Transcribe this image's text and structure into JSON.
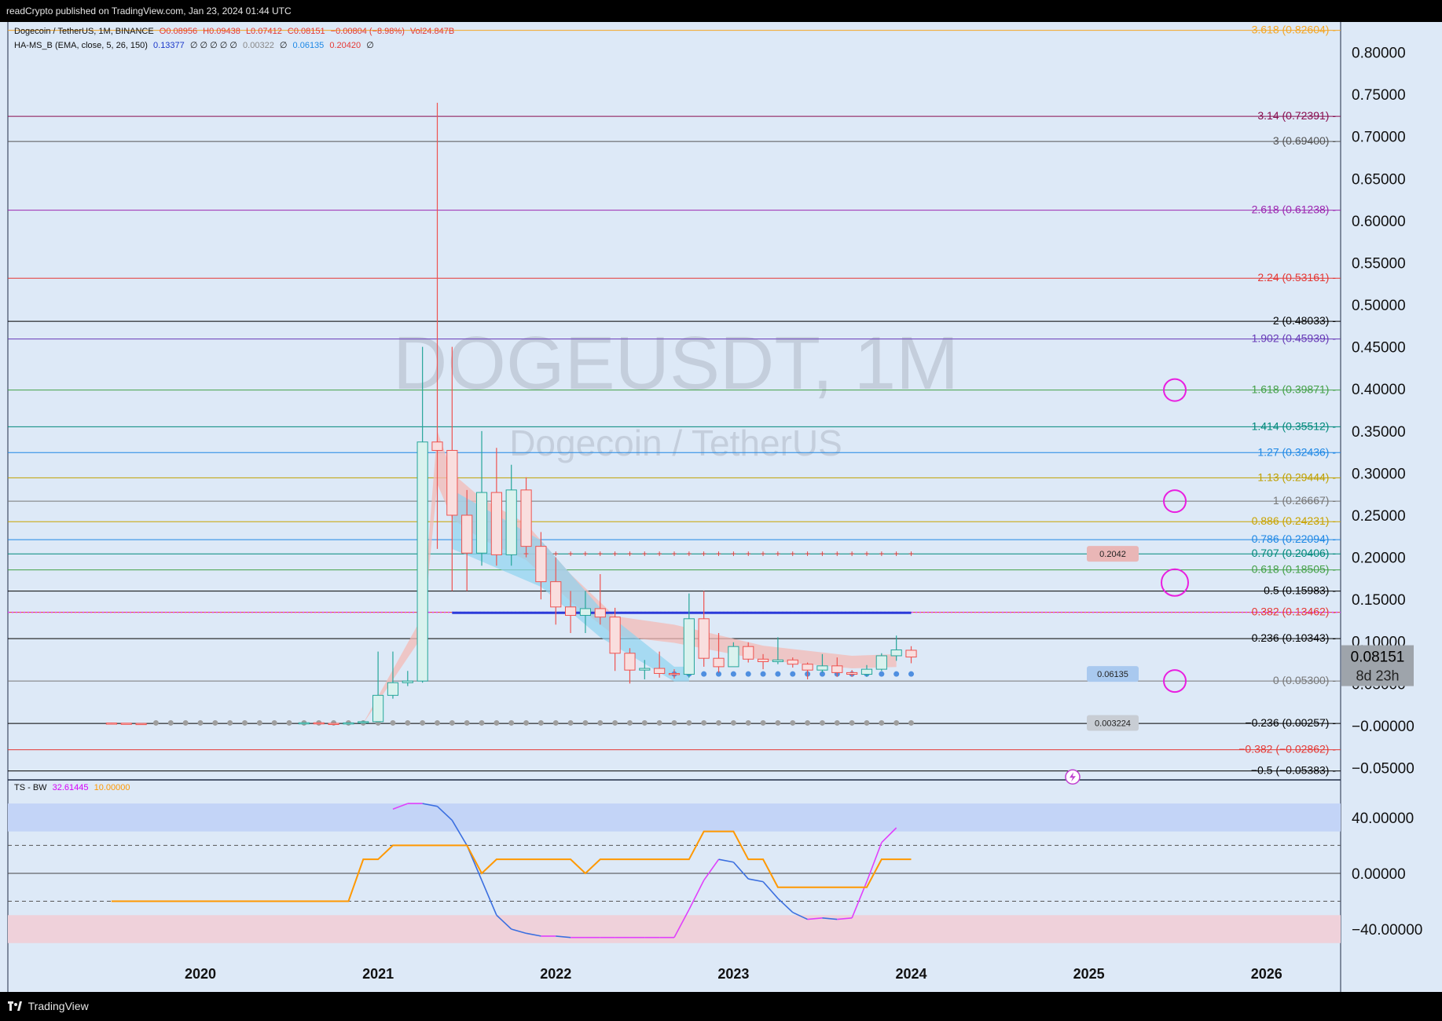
{
  "header": {
    "publisher": "readCrypto published on TradingView.com, Jan 23, 2024 01:44 UTC"
  },
  "footer": {
    "brand": "TradingView"
  },
  "colors": {
    "bg": "#dde9f7",
    "up": "#26a69a",
    "down": "#ef5350",
    "osc_blue": "#3b6fe0",
    "osc_magenta": "#e040fb",
    "signal": "#ff9800"
  },
  "legend_main": {
    "symbol": "Dogecoin / TetherUS, 1M, BINANCE",
    "o": "O0.08956",
    "h": "H0.09438",
    "l": "L0.07412",
    "c": "C0.08151",
    "chg": "−0.00804 (−8.98%)",
    "vol": "Vol24.847B"
  },
  "legend_ind": {
    "name": "HA-MS_B (EMA, close, 5, 26, 150)",
    "v1": "0.13377",
    "v2": "∅ ∅ ∅ ∅ ∅",
    "v3": "0.00322",
    "v4": "∅",
    "v5": "0.06135",
    "v6": "0.20420",
    "v7": "∅"
  },
  "legend_osc": {
    "name": "TS - BW",
    "v1": "32.61445",
    "v2": "10.00000"
  },
  "watermark": {
    "title": "DOGEUSDT, 1M",
    "subtitle": "Dogecoin / TetherUS"
  },
  "chart_data": [
    {
      "type": "candlestick",
      "title": "DOGEUSDT, 1M",
      "x_ticks": [
        "2020",
        "2021",
        "2022",
        "2023",
        "2024",
        "2025",
        "2026"
      ],
      "y_ticks": [
        "0.80000",
        "0.75000",
        "0.70000",
        "0.65000",
        "0.60000",
        "0.55000",
        "0.50000",
        "0.45000",
        "0.40000",
        "0.35000",
        "0.30000",
        "0.25000",
        "0.20000",
        "0.15000",
        "0.10000",
        "0.05000",
        "−0.00000",
        "−0.05000"
      ],
      "ylim": [
        -0.057,
        0.836
      ],
      "xlim": [
        "2018-12",
        "2026-06"
      ],
      "fib_levels": [
        {
          "label": "3.618 (0.82604)",
          "value": 0.82604,
          "color": "#f5a623"
        },
        {
          "label": "3.14 (0.72391)",
          "value": 0.72391,
          "color": "#880e4f"
        },
        {
          "label": "3 (0.69400)",
          "value": 0.694,
          "color": "#555555"
        },
        {
          "label": "2.618 (0.61238)",
          "value": 0.61238,
          "color": "#9c27b0"
        },
        {
          "label": "2.24 (0.53161)",
          "value": 0.53161,
          "color": "#e53935"
        },
        {
          "label": "2 (0.48033)",
          "value": 0.48033,
          "color": "#000000"
        },
        {
          "label": "1.902 (0.45939)",
          "value": 0.45939,
          "color": "#673ab7"
        },
        {
          "label": "1.618 (0.39871)",
          "value": 0.39871,
          "color": "#43a047"
        },
        {
          "label": "1.414 (0.35512)",
          "value": 0.35512,
          "color": "#00897b"
        },
        {
          "label": "1.27 (0.32436)",
          "value": 0.32436,
          "color": "#1e88e5"
        },
        {
          "label": "1.13 (0.29444)",
          "value": 0.29444,
          "color": "#c0a000"
        },
        {
          "label": "1 (0.26667)",
          "value": 0.26667,
          "color": "#777777"
        },
        {
          "label": "0.886 (0.24231)",
          "value": 0.24231,
          "color": "#c9a300"
        },
        {
          "label": "0.786 (0.22094)",
          "value": 0.22094,
          "color": "#1e88e5"
        },
        {
          "label": "0.707 (0.20406)",
          "value": 0.20406,
          "color": "#00897b"
        },
        {
          "label": "0.618 (0.18505)",
          "value": 0.18505,
          "color": "#43a047"
        },
        {
          "label": "0.5 (0.15983)",
          "value": 0.15983,
          "color": "#000000"
        },
        {
          "label": "0.382 (0.13462)",
          "value": 0.13462,
          "color": "#e53935"
        },
        {
          "label": "0.236 (0.10343)",
          "value": 0.10343,
          "color": "#000000"
        },
        {
          "label": "0 (0.05300)",
          "value": 0.053,
          "color": "#777777"
        },
        {
          "label": "−0.236 (0.00257)",
          "value": 0.00257,
          "color": "#000000"
        },
        {
          "label": "−0.382 (−0.02862)",
          "value": -0.02862,
          "color": "#e53935"
        },
        {
          "label": "−0.5 (−0.05383)",
          "value": -0.05383,
          "color": "#000000"
        }
      ],
      "candles": [
        {
          "t": "2019-07",
          "o": 0.0031,
          "h": 0.0035,
          "l": 0.0028,
          "c": 0.0029
        },
        {
          "t": "2019-08",
          "o": 0.0029,
          "h": 0.0031,
          "l": 0.0025,
          "c": 0.0026
        },
        {
          "t": "2019-09",
          "o": 0.0026,
          "h": 0.0028,
          "l": 0.0024,
          "c": 0.0025
        },
        {
          "t": "2020-08",
          "o": 0.0028,
          "h": 0.0035,
          "l": 0.0027,
          "c": 0.0034
        },
        {
          "t": "2020-09",
          "o": 0.0034,
          "h": 0.0035,
          "l": 0.0026,
          "c": 0.0027
        },
        {
          "t": "2020-10",
          "o": 0.0027,
          "h": 0.0028,
          "l": 0.0025,
          "c": 0.0026
        },
        {
          "t": "2020-11",
          "o": 0.0026,
          "h": 0.0035,
          "l": 0.0025,
          "c": 0.0033
        },
        {
          "t": "2020-12",
          "o": 0.0033,
          "h": 0.0056,
          "l": 0.003,
          "c": 0.0047
        },
        {
          "t": "2021-01",
          "o": 0.0047,
          "h": 0.088,
          "l": 0.0045,
          "c": 0.036
        },
        {
          "t": "2021-02",
          "o": 0.036,
          "h": 0.088,
          "l": 0.032,
          "c": 0.051
        },
        {
          "t": "2021-03",
          "o": 0.051,
          "h": 0.065,
          "l": 0.047,
          "c": 0.053
        },
        {
          "t": "2021-04",
          "o": 0.053,
          "h": 0.45,
          "l": 0.051,
          "c": 0.337
        },
        {
          "t": "2021-05",
          "o": 0.337,
          "h": 0.74,
          "l": 0.21,
          "c": 0.327
        },
        {
          "t": "2021-06",
          "o": 0.327,
          "h": 0.45,
          "l": 0.16,
          "c": 0.25
        },
        {
          "t": "2021-07",
          "o": 0.25,
          "h": 0.28,
          "l": 0.16,
          "c": 0.205
        },
        {
          "t": "2021-08",
          "o": 0.205,
          "h": 0.35,
          "l": 0.19,
          "c": 0.277
        },
        {
          "t": "2021-09",
          "o": 0.277,
          "h": 0.33,
          "l": 0.19,
          "c": 0.203
        },
        {
          "t": "2021-10",
          "o": 0.203,
          "h": 0.31,
          "l": 0.19,
          "c": 0.28
        },
        {
          "t": "2021-11",
          "o": 0.28,
          "h": 0.295,
          "l": 0.2,
          "c": 0.213
        },
        {
          "t": "2021-12",
          "o": 0.213,
          "h": 0.23,
          "l": 0.15,
          "c": 0.171
        },
        {
          "t": "2022-01",
          "o": 0.171,
          "h": 0.2,
          "l": 0.12,
          "c": 0.141
        },
        {
          "t": "2022-02",
          "o": 0.141,
          "h": 0.16,
          "l": 0.11,
          "c": 0.131
        },
        {
          "t": "2022-03",
          "o": 0.131,
          "h": 0.16,
          "l": 0.11,
          "c": 0.139
        },
        {
          "t": "2022-04",
          "o": 0.139,
          "h": 0.18,
          "l": 0.12,
          "c": 0.129
        },
        {
          "t": "2022-05",
          "o": 0.129,
          "h": 0.14,
          "l": 0.065,
          "c": 0.086
        },
        {
          "t": "2022-06",
          "o": 0.086,
          "h": 0.092,
          "l": 0.05,
          "c": 0.066
        },
        {
          "t": "2022-07",
          "o": 0.066,
          "h": 0.078,
          "l": 0.055,
          "c": 0.068
        },
        {
          "t": "2022-08",
          "o": 0.068,
          "h": 0.088,
          "l": 0.057,
          "c": 0.062
        },
        {
          "t": "2022-09",
          "o": 0.062,
          "h": 0.067,
          "l": 0.056,
          "c": 0.061
        },
        {
          "t": "2022-10",
          "o": 0.061,
          "h": 0.157,
          "l": 0.057,
          "c": 0.127
        },
        {
          "t": "2022-11",
          "o": 0.127,
          "h": 0.16,
          "l": 0.07,
          "c": 0.08
        },
        {
          "t": "2022-12",
          "o": 0.08,
          "h": 0.11,
          "l": 0.063,
          "c": 0.07
        },
        {
          "t": "2023-01",
          "o": 0.07,
          "h": 0.099,
          "l": 0.07,
          "c": 0.094
        },
        {
          "t": "2023-02",
          "o": 0.094,
          "h": 0.099,
          "l": 0.075,
          "c": 0.079
        },
        {
          "t": "2023-03",
          "o": 0.079,
          "h": 0.085,
          "l": 0.067,
          "c": 0.076
        },
        {
          "t": "2023-04",
          "o": 0.076,
          "h": 0.105,
          "l": 0.073,
          "c": 0.078
        },
        {
          "t": "2023-05",
          "o": 0.078,
          "h": 0.081,
          "l": 0.069,
          "c": 0.073
        },
        {
          "t": "2023-06",
          "o": 0.073,
          "h": 0.075,
          "l": 0.055,
          "c": 0.066
        },
        {
          "t": "2023-07",
          "o": 0.066,
          "h": 0.085,
          "l": 0.063,
          "c": 0.071
        },
        {
          "t": "2023-08",
          "o": 0.071,
          "h": 0.081,
          "l": 0.058,
          "c": 0.063
        },
        {
          "t": "2023-09",
          "o": 0.063,
          "h": 0.066,
          "l": 0.058,
          "c": 0.061
        },
        {
          "t": "2023-10",
          "o": 0.061,
          "h": 0.072,
          "l": 0.058,
          "c": 0.067
        },
        {
          "t": "2023-11",
          "o": 0.067,
          "h": 0.086,
          "l": 0.065,
          "c": 0.083
        },
        {
          "t": "2023-12",
          "o": 0.083,
          "h": 0.107,
          "l": 0.077,
          "c": 0.09
        },
        {
          "t": "2024-01",
          "o": 0.08956,
          "h": 0.09438,
          "l": 0.07412,
          "c": 0.08151
        }
      ],
      "dotted_levels": [
        {
          "label": "0.2042",
          "value": 0.2042,
          "from": "2021-10",
          "to": "2024-01",
          "color": "#e53935"
        },
        {
          "label": "0.06135",
          "value": 0.06135,
          "from": "2022-09",
          "to": "2024-01",
          "color": "#4f8fe0"
        },
        {
          "label": "0.003224",
          "value": 0.003224,
          "from": "2019-10",
          "to": "2024-01",
          "color": "#9e9e9e"
        }
      ],
      "blue_line": {
        "value": 0.134,
        "from": "2021-06",
        "to": "2024-01"
      },
      "circles": [
        0.39871,
        0.26667,
        0.17,
        0.053
      ],
      "price_tag": {
        "price": "0.08151",
        "countdown": "8d 23h"
      },
      "flash_icon": "lightning-icon"
    },
    {
      "type": "line",
      "title": "TS - BW",
      "y_ticks": [
        "40.00000",
        "0.00000",
        "−40.00000"
      ],
      "ylim": [
        -58,
        63
      ],
      "bands": {
        "upper": [
          30,
          50
        ],
        "lower": [
          -50,
          -30
        ],
        "dashed": [
          20,
          -20
        ]
      },
      "series": [
        {
          "values": [
            [
              "2021-02",
              46
            ],
            [
              "2021-03",
              50
            ],
            [
              "2021-04",
              50
            ],
            [
              "2021-05",
              48
            ],
            [
              "2021-06",
              38
            ],
            [
              "2021-07",
              20
            ],
            [
              "2021-08",
              -5
            ],
            [
              "2021-09",
              -30
            ],
            [
              "2021-10",
              -40
            ],
            [
              "2021-11",
              -43
            ],
            [
              "2021-12",
              -45
            ],
            [
              "2022-01",
              -45
            ],
            [
              "2022-02",
              -46
            ],
            [
              "2022-03",
              -46
            ],
            [
              "2022-04",
              -46
            ],
            [
              "2022-05",
              -46
            ],
            [
              "2022-06",
              -46
            ],
            [
              "2022-07",
              -46
            ],
            [
              "2022-08",
              -46
            ],
            [
              "2022-09",
              -46
            ],
            [
              "2022-10",
              -26
            ],
            [
              "2022-11",
              -5
            ],
            [
              "2022-12",
              10
            ],
            [
              "2023-01",
              8
            ],
            [
              "2023-02",
              -4
            ],
            [
              "2023-03",
              -6
            ],
            [
              "2023-04",
              -18
            ],
            [
              "2023-05",
              -28
            ],
            [
              "2023-06",
              -33
            ],
            [
              "2023-07",
              -32
            ],
            [
              "2023-08",
              -33
            ],
            [
              "2023-09",
              -32
            ],
            [
              "2023-10",
              -6
            ],
            [
              "2023-11",
              22
            ],
            [
              "2023-12",
              32.61
            ]
          ]
        },
        {
          "values": [
            [
              "2019-07",
              -20
            ],
            [
              "2019-08",
              -20
            ],
            [
              "2019-09",
              -20
            ],
            [
              "2019-10",
              -20
            ],
            [
              "2019-11",
              -20
            ],
            [
              "2019-12",
              -20
            ],
            [
              "2020-01",
              -20
            ],
            [
              "2020-02",
              -20
            ],
            [
              "2020-03",
              -20
            ],
            [
              "2020-04",
              -20
            ],
            [
              "2020-05",
              -20
            ],
            [
              "2020-06",
              -20
            ],
            [
              "2020-07",
              -20
            ],
            [
              "2020-08",
              -20
            ],
            [
              "2020-09",
              -20
            ],
            [
              "2020-10",
              -20
            ],
            [
              "2020-11",
              -20
            ],
            [
              "2020-12",
              10
            ],
            [
              "2021-01",
              10
            ],
            [
              "2021-02",
              20
            ],
            [
              "2021-03",
              20
            ],
            [
              "2021-04",
              20
            ],
            [
              "2021-05",
              20
            ],
            [
              "2021-06",
              20
            ],
            [
              "2021-07",
              20
            ],
            [
              "2021-08",
              0
            ],
            [
              "2021-09",
              10
            ],
            [
              "2021-10",
              10
            ],
            [
              "2021-11",
              10
            ],
            [
              "2021-12",
              10
            ],
            [
              "2022-01",
              10
            ],
            [
              "2022-02",
              10
            ],
            [
              "2022-03",
              0
            ],
            [
              "2022-04",
              10
            ],
            [
              "2022-05",
              10
            ],
            [
              "2022-06",
              10
            ],
            [
              "2022-07",
              10
            ],
            [
              "2022-08",
              10
            ],
            [
              "2022-09",
              10
            ],
            [
              "2022-10",
              10
            ],
            [
              "2022-11",
              30
            ],
            [
              "2022-12",
              30
            ],
            [
              "2023-01",
              30
            ],
            [
              "2023-02",
              10
            ],
            [
              "2023-03",
              10
            ],
            [
              "2023-04",
              -10
            ],
            [
              "2023-05",
              -10
            ],
            [
              "2023-06",
              -10
            ],
            [
              "2023-07",
              -10
            ],
            [
              "2023-08",
              -10
            ],
            [
              "2023-09",
              -10
            ],
            [
              "2023-10",
              -10
            ],
            [
              "2023-11",
              10
            ],
            [
              "2023-12",
              10
            ],
            [
              "2024-01",
              10
            ]
          ]
        }
      ]
    }
  ]
}
